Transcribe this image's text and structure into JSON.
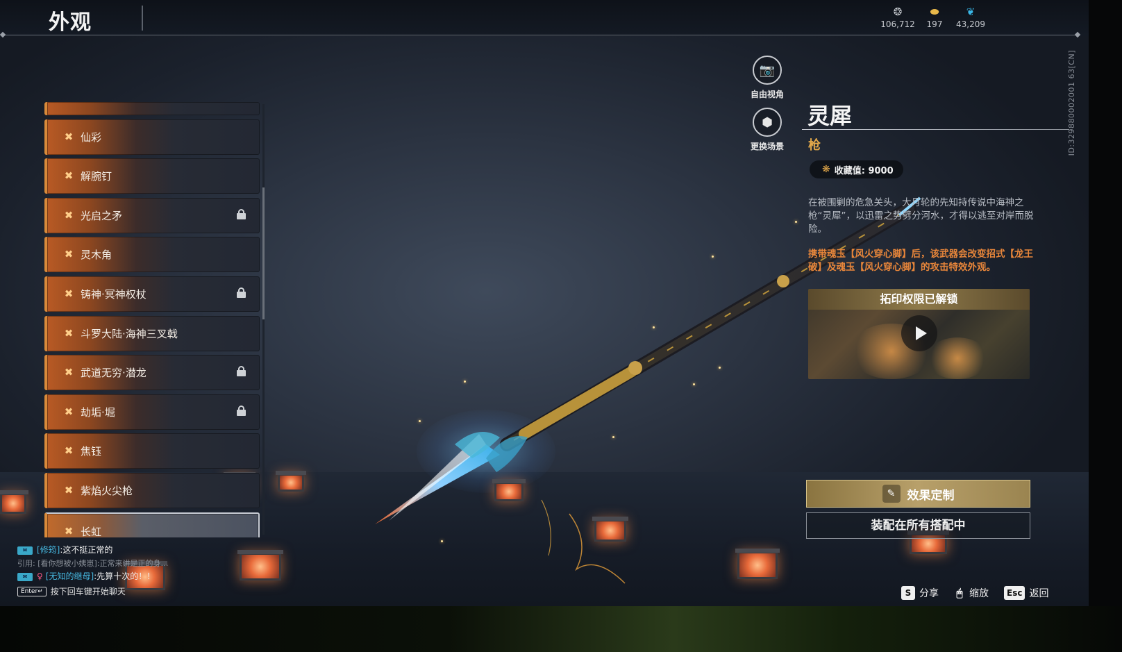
{
  "header": {
    "title": "外观",
    "currencies": [
      {
        "icon": "soul-jade-icon",
        "value": "106,712"
      },
      {
        "icon": "gold-ingot-icon",
        "value": "197"
      },
      {
        "icon": "feather-icon",
        "value": "43,209"
      }
    ]
  },
  "camera": {
    "free_view_label": "自由视角",
    "change_scene_label": "更换场景"
  },
  "weapon_list": {
    "items": [
      {
        "label": "",
        "locked": false
      },
      {
        "label": "仙彩",
        "locked": false
      },
      {
        "label": "解腕钉",
        "locked": false
      },
      {
        "label": "光启之矛",
        "locked": true
      },
      {
        "label": "灵木角",
        "locked": false
      },
      {
        "label": "铸神·冥神权杖",
        "locked": true
      },
      {
        "label": "斗罗大陆·海神三叉戟",
        "locked": false
      },
      {
        "label": "武道无穷·潜龙",
        "locked": true
      },
      {
        "label": "劫垢·堀",
        "locked": true
      },
      {
        "label": "焦钰",
        "locked": false
      },
      {
        "label": "紫焰火尖枪",
        "locked": false
      },
      {
        "label": "长虹",
        "locked": false,
        "selected": true
      }
    ],
    "scroll_fraction": 0.2
  },
  "detail": {
    "vertical_id": "ID:329880002001 63[CN]",
    "name": "灵犀",
    "type": "枪",
    "collect_label": "收藏值: 9000",
    "description": "在被围剿的危急关头，大月轮的先知持传说中海神之枪“灵犀”，以迅雷之势劈分河水，才得以逃至对岸而脱险。",
    "effect_note": "携带魂玉【风火穿心脚】后，该武器会改变招式【龙王破】及魂玉【风火穿心脚】的攻击特效外观。",
    "video_banner": "拓印权限已解锁",
    "custom_button": "效果定制",
    "equip_button": "装配在所有搭配中"
  },
  "hotkeys": [
    {
      "key": "S",
      "label": "分享",
      "mouse": false
    },
    {
      "key": "🖱",
      "label": "缩放",
      "mouse": true
    },
    {
      "key": "Esc",
      "label": "返回",
      "mouse": false
    }
  ],
  "chat": {
    "line1_name": "[修筠]",
    "line1_msg": ":这不挺正常的",
    "line2_quote": "引用: [看你想被小姨崽]:正常来讲是正的身…",
    "line3_name": "[无知的继母]",
    "line3_msg": ":先算十次的！！",
    "enter_key": "Enter↵",
    "enter_hint": "按下回车键开始聊天"
  },
  "colors": {
    "accent_gold": "#e3a84a",
    "effect_orange": "#e8863a",
    "chat_name": "#46b8e0"
  }
}
